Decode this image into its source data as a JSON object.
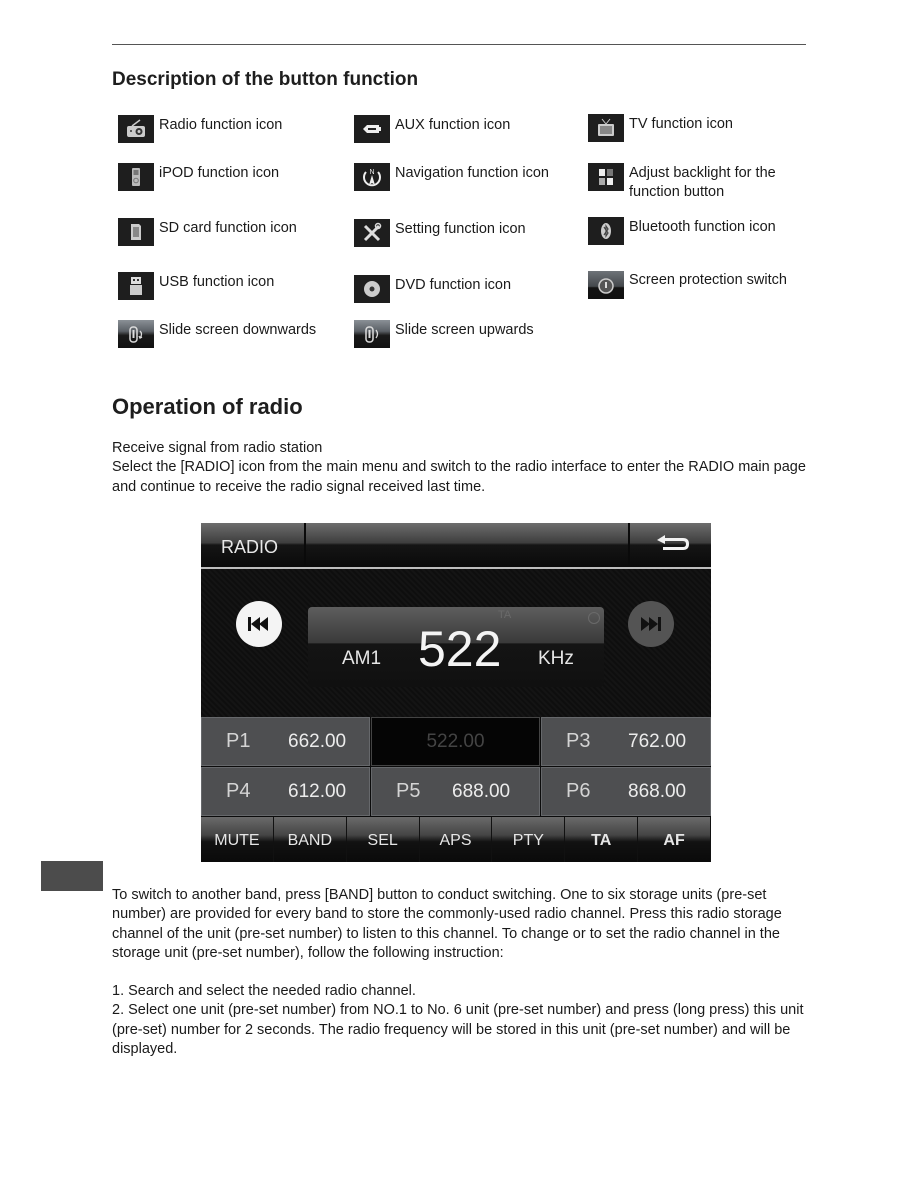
{
  "headings": {
    "description": "Description of the button function",
    "operation": "Operation of radio"
  },
  "icon_legend": [
    {
      "icon": "radio-icon",
      "label": "Radio function icon"
    },
    {
      "icon": "aux-icon",
      "label": "AUX function icon"
    },
    {
      "icon": "tv-icon",
      "label": "TV function icon"
    },
    {
      "icon": "ipod-icon",
      "label": "iPOD function icon"
    },
    {
      "icon": "navigation-icon",
      "label": "Navigation function icon"
    },
    {
      "icon": "backlight-icon",
      "label": "Adjust backlight for the function button"
    },
    {
      "icon": "sd-card-icon",
      "label": "SD card function icon"
    },
    {
      "icon": "settings-icon",
      "label": "Setting function icon"
    },
    {
      "icon": "bluetooth-icon",
      "label": "Bluetooth function icon"
    },
    {
      "icon": "usb-icon",
      "label": "USB function icon"
    },
    {
      "icon": "dvd-icon",
      "label": "DVD function icon"
    },
    {
      "icon": "screen-protection-icon",
      "label": "Screen protection switch"
    },
    {
      "icon": "slide-down-icon",
      "label": "Slide screen downwards"
    },
    {
      "icon": "slide-up-icon",
      "label": "Slide screen upwards"
    }
  ],
  "intro": {
    "line1": "Receive signal from radio station",
    "line2": "Select the [RADIO] icon from the main menu and switch to the radio interface to enter the RADIO main page and continue to receive the radio signal received last time."
  },
  "radio_ui": {
    "title": "RADIO",
    "band": "AM1",
    "frequency": "522",
    "unit": "KHz",
    "ta_indicator": "TA",
    "presets": [
      {
        "name": "P1",
        "value": "662.00"
      },
      {
        "name": "",
        "value": "522.00",
        "active": true
      },
      {
        "name": "P3",
        "value": "762.00"
      },
      {
        "name": "P4",
        "value": "612.00"
      },
      {
        "name": "P5",
        "value": "688.00"
      },
      {
        "name": "P6",
        "value": "868.00"
      }
    ],
    "buttons": [
      "MUTE",
      "BAND",
      "SEL",
      "APS",
      "PTY",
      "TA",
      "AF"
    ]
  },
  "body": {
    "para1": "To switch to another band, press [BAND] button to conduct switching. One to six storage units (pre-set number) are provided for every band to store the commonly-used radio channel. Press this radio storage channel of the unit (pre-set number) to listen to this channel. To change or to set the radio channel in the storage unit (pre-set number), follow the following instruction:",
    "step1": "1. Search and select the needed radio channel.",
    "step2": "2. Select one unit (pre-set number) from NO.1 to No. 6 unit (pre-set number) and press (long press) this unit (pre-set) number for 2 seconds. The radio frequency will be stored in this unit (pre-set number) and will be displayed."
  }
}
